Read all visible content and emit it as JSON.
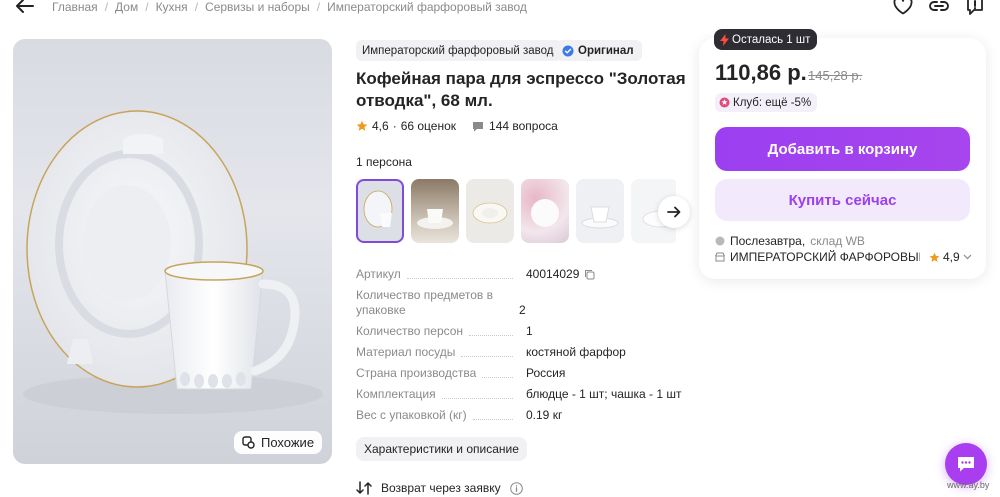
{
  "breadcrumbs": [
    "Главная",
    "Дом",
    "Кухня",
    "Сервизы и наборы",
    "Императорский фарфоровый завод"
  ],
  "product": {
    "brand": "Императорский фарфоровый завод",
    "original_badge": "Оригинал",
    "title": "Кофейная пара для эспрессо \"Золотая отводка\", 68 мл.",
    "rating": "4,6",
    "rating_sep": "·",
    "reviews": "66 оценок",
    "questions": "144 вопроса",
    "variant_label": "1 персона",
    "similar_label": "Похожие"
  },
  "specs": [
    {
      "name": "Артикул",
      "value": "40014029"
    },
    {
      "name": "Количество предметов в упаковке",
      "value": "2"
    },
    {
      "name": "Количество персон",
      "value": "1"
    },
    {
      "name": "Материал посуды",
      "value": "костяной фарфор"
    },
    {
      "name": "Страна производства",
      "value": "Россия"
    },
    {
      "name": "Комплектация",
      "value": "блюдце - 1 шт; чашка - 1 шт"
    },
    {
      "name": "Вес с упаковкой (кг)",
      "value": "0.19 кг"
    }
  ],
  "characteristics_button": "Характеристики и описание",
  "return_text": "Возврат через заявку",
  "buy_box": {
    "stock_badge": "Осталась 1 шт",
    "price": "110,86 р.",
    "old_price": "145,28 р.",
    "club": "Клуб: ещё -5%",
    "add_to_cart": "Добавить в корзину",
    "buy_now": "Купить сейчас",
    "delivery_when": "Послезавтра,",
    "delivery_where": "склад WB",
    "seller": "ИМПЕРАТОРСКИЙ ФАРФОРОВЫЙ З",
    "seller_rating": "4,9"
  },
  "watermark": "www.ay.by",
  "colors": {
    "accent": "#a93df0",
    "accent_light": "#f3e9fc",
    "text": "#242424",
    "muted": "#8a8a8e",
    "star": "#f29a1f"
  }
}
